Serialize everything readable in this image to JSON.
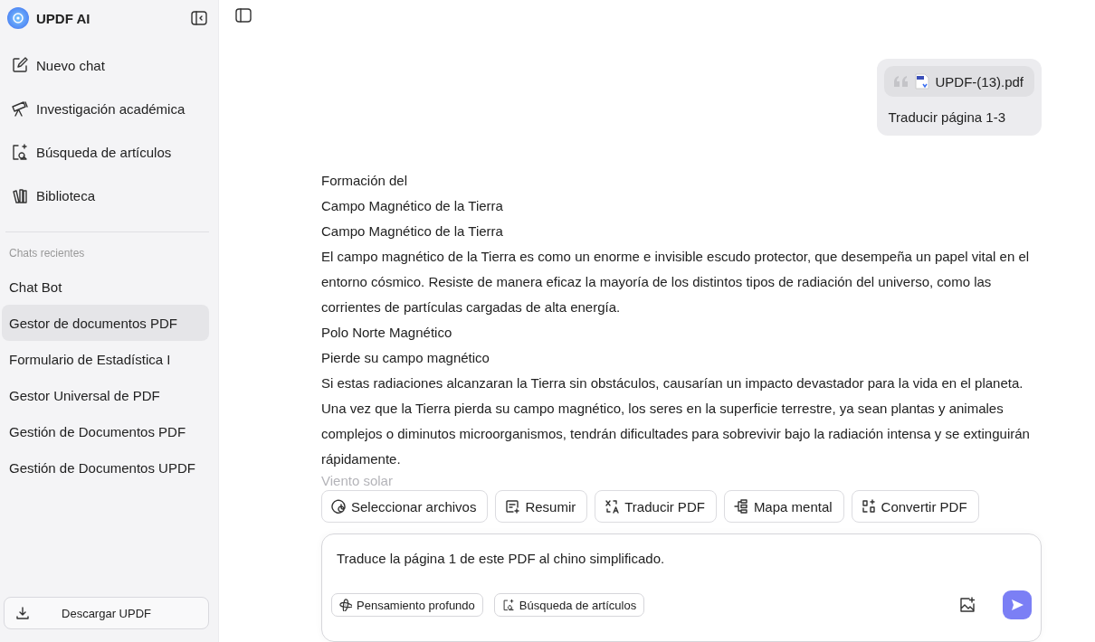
{
  "sidebar": {
    "app_name": "UPDF AI",
    "nav_items": [
      {
        "label": "Nuevo chat"
      },
      {
        "label": "Investigación académica"
      },
      {
        "label": "Búsqueda de artículos"
      },
      {
        "label": "Biblioteca"
      }
    ],
    "recent_heading": "Chats recientes",
    "recent_chats": [
      {
        "label": "Chat Bot",
        "selected": false
      },
      {
        "label": "Gestor de documentos PDF",
        "selected": true
      },
      {
        "label": "Formulario de Estadística I",
        "selected": false
      },
      {
        "label": "Gestor Universal de PDF",
        "selected": false
      },
      {
        "label": "Gestión de Documentos PDF",
        "selected": false
      },
      {
        "label": "Gestión de Documentos UPDF",
        "selected": false
      }
    ],
    "download_button": "Descargar UPDF"
  },
  "user_message": {
    "attachment": "UPDF-(13).pdf",
    "text": "Traducir página 1-3"
  },
  "assistant_message": [
    {
      "text": "Formación del",
      "faded": false
    },
    {
      "text": "Campo Magnético de la Tierra",
      "faded": false
    },
    {
      "text": "Campo Magnético de la Tierra",
      "faded": false
    },
    {
      "text": "El campo magnético de la Tierra es como un enorme e invisible escudo protector, que desempeña un papel vital en el entorno cósmico. Resiste de manera eficaz la mayoría de los distintos tipos de radiación del universo, como las corrientes de partículas cargadas de alta energía.",
      "faded": false
    },
    {
      "text": "Polo Norte Magnético",
      "faded": false
    },
    {
      "text": "Pierde su campo magnético",
      "faded": false
    },
    {
      "text": "Si estas radiaciones alcanzaran la Tierra sin obstáculos, causarían un impacto devastador para la vida en el planeta.",
      "faded": false
    },
    {
      "text": "Una vez que la Tierra pierda su campo magnético, los seres en la superficie terrestre, ya sean plantas y animales complejos o diminutos microorganismos, tendrán dificultades para sobrevivir bajo la radiación intensa y se extinguirán rápidamente.",
      "faded": false
    },
    {
      "text": "Viento solar",
      "faded": true
    }
  ],
  "quick_actions": [
    {
      "label": "Seleccionar archivos"
    },
    {
      "label": "Resumir"
    },
    {
      "label": "Traducir PDF"
    },
    {
      "label": "Mapa mental"
    },
    {
      "label": "Convertir PDF"
    }
  ],
  "composer": {
    "value": "Traduce la página 1 de este PDF al chino simplificado.",
    "options": [
      {
        "label": "Pensamiento profundo"
      },
      {
        "label": "Búsqueda de artículos"
      }
    ]
  }
}
